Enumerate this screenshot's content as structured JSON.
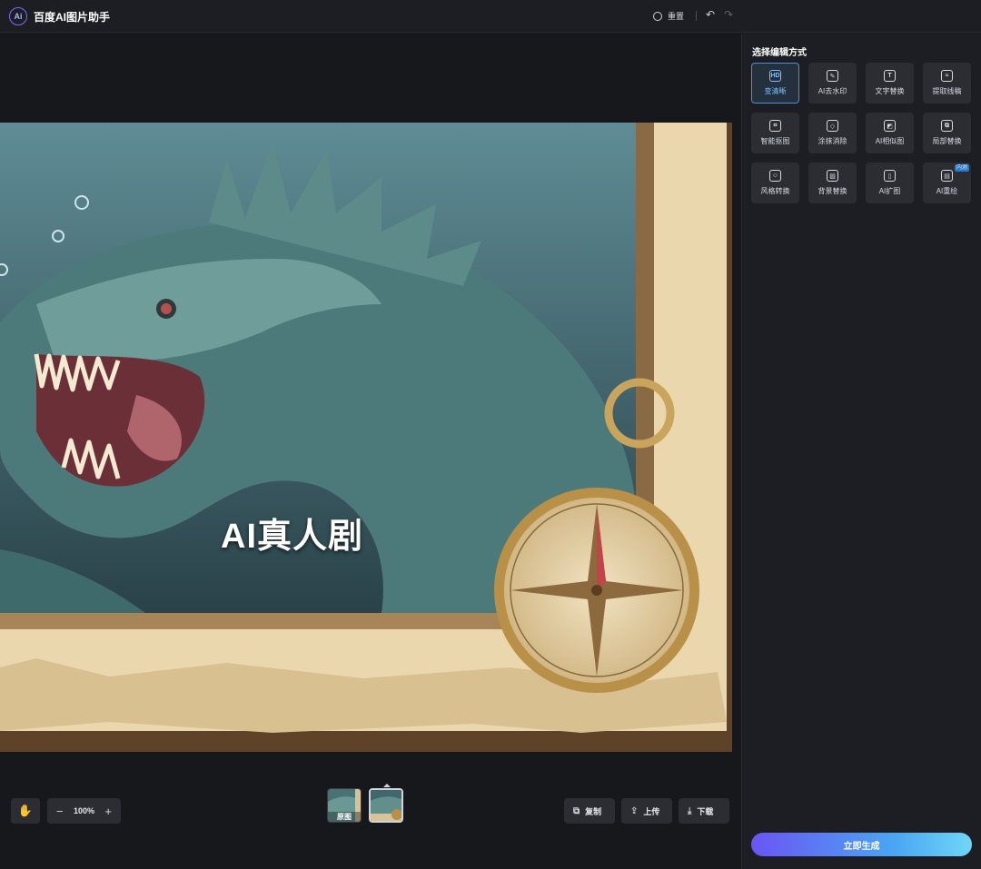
{
  "header": {
    "logo_text": "Ai",
    "app_title": "百度AI图片助手",
    "reset_label": "重置",
    "undo_icon": "undo-icon",
    "redo_icon": "redo-icon"
  },
  "canvas": {
    "overlay_text": "AI真人剧",
    "zoom_value": "100%",
    "zoom_out_glyph": "−",
    "zoom_in_glyph": "+"
  },
  "thumbnails": [
    {
      "label": "原图",
      "active": false
    },
    {
      "label": "",
      "active": true
    }
  ],
  "actions": {
    "copy": "复制",
    "upload": "上传",
    "download": "下载"
  },
  "panel": {
    "title": "选择编辑方式",
    "tools": [
      {
        "label": "变清晰",
        "icon_text": "HD",
        "icon": "hd-icon",
        "selected": true
      },
      {
        "label": "AI去水印",
        "icon_text": "✎",
        "icon": "magic-wand-icon"
      },
      {
        "label": "文字替换",
        "icon_text": "T",
        "icon": "text-replace-icon"
      },
      {
        "label": "提取线稿",
        "icon_text": "≈",
        "icon": "line-art-icon"
      },
      {
        "label": "智能抠图",
        "icon_text": "⌗",
        "icon": "cutout-icon"
      },
      {
        "label": "涂抹消除",
        "icon_text": "◇",
        "icon": "eraser-icon"
      },
      {
        "label": "AI相似图",
        "icon_text": "◩",
        "icon": "similar-image-icon"
      },
      {
        "label": "局部替换",
        "icon_text": "⧉",
        "icon": "partial-replace-icon"
      },
      {
        "label": "风格转换",
        "icon_text": "☺",
        "icon": "style-transfer-icon"
      },
      {
        "label": "背景替换",
        "icon_text": "▨",
        "icon": "background-replace-icon"
      },
      {
        "label": "AI扩图",
        "icon_text": "▯",
        "icon": "expand-image-icon"
      },
      {
        "label": "AI重绘",
        "icon_text": "▤",
        "icon": "redraw-icon",
        "badge": "内测"
      }
    ],
    "generate_label": "立即生成"
  },
  "colors": {
    "accent_start": "#6a55f5",
    "accent_end": "#6fd6f7",
    "selected_border": "#4f8fd6"
  }
}
